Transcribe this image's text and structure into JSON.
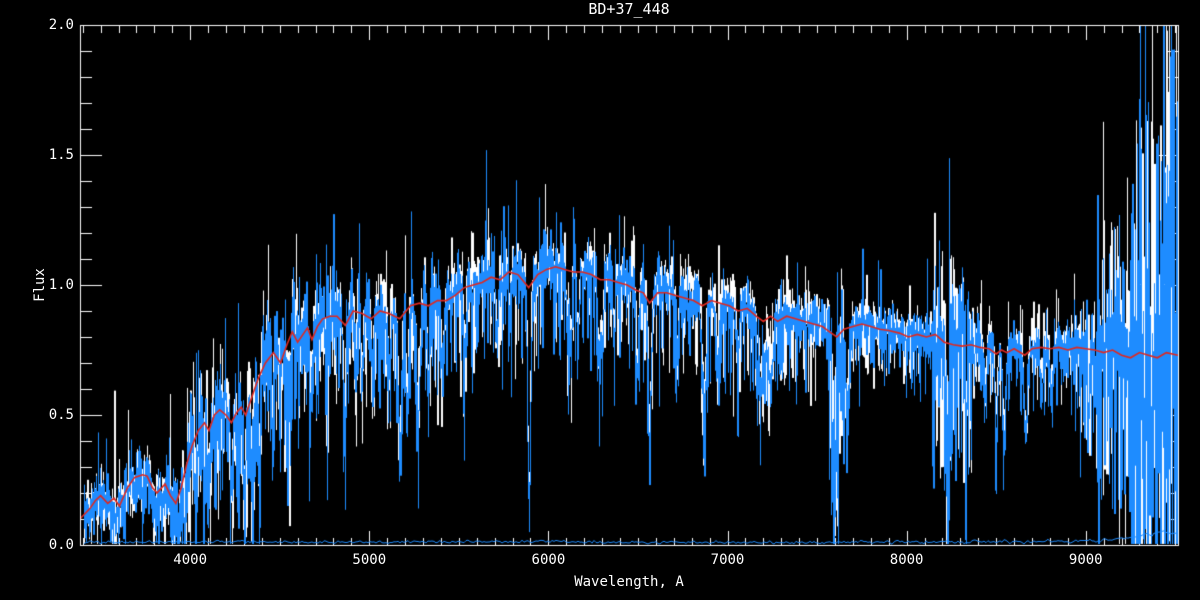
{
  "chart_data": {
    "type": "line",
    "title": "BD+37_448",
    "xlabel": "Wavelength, A",
    "ylabel": "Flux",
    "xlim": [
      3385,
      9515
    ],
    "ylim": [
      0.0,
      2.0
    ],
    "x_major_ticks": [
      4000,
      5000,
      6000,
      7000,
      8000,
      9000
    ],
    "x_minor_step": 100,
    "y_major_ticks": [
      0.0,
      0.5,
      1.0,
      1.5,
      2.0
    ],
    "y_minor_step": 0.1,
    "y_tick_decimals": 1,
    "grid": false,
    "legend": "none",
    "background_color": "#000000",
    "axis_color": "#ffffff",
    "noise_seed": 11,
    "series": [
      {
        "name": "observed-spectrum-white",
        "label": "observed spectrum (white)",
        "color": "#ffffff",
        "style": "noisy",
        "sigma_scale": 0.9,
        "line_depth_scale": 0.85
      },
      {
        "name": "observed-spectrum-blue",
        "label": "observed spectrum (blue)",
        "color": "#1e8cff",
        "style": "noisy",
        "sigma_scale": 1.0,
        "line_depth_scale": 1.0
      },
      {
        "name": "error-spectrum",
        "label": "error spectrum (bottom blue line)",
        "color": "#1e8cff",
        "style": "line",
        "width": 1,
        "points": [
          [
            3385,
            0.01
          ],
          [
            3700,
            0.012
          ],
          [
            4200,
            0.012
          ],
          [
            5000,
            0.011
          ],
          [
            5900,
            0.013
          ],
          [
            6500,
            0.01
          ],
          [
            7500,
            0.01
          ],
          [
            8200,
            0.012
          ],
          [
            8800,
            0.013
          ],
          [
            9000,
            0.016
          ],
          [
            9150,
            0.022
          ],
          [
            9280,
            0.03
          ],
          [
            9380,
            0.045
          ],
          [
            9440,
            0.055
          ],
          [
            9480,
            0.04
          ],
          [
            9515,
            0.05
          ]
        ]
      },
      {
        "name": "smoothed-spectrum-red",
        "label": "smoothed spectrum (red)",
        "color": "#e02820",
        "style": "line",
        "width": 1.6,
        "points": "continuum"
      }
    ],
    "continuum": [
      [
        3385,
        0.1
      ],
      [
        3440,
        0.14
      ],
      [
        3470,
        0.17
      ],
      [
        3500,
        0.19
      ],
      [
        3540,
        0.16
      ],
      [
        3575,
        0.18
      ],
      [
        3605,
        0.15
      ],
      [
        3650,
        0.22
      ],
      [
        3690,
        0.26
      ],
      [
        3735,
        0.27
      ],
      [
        3760,
        0.265
      ],
      [
        3790,
        0.22
      ],
      [
        3815,
        0.2
      ],
      [
        3860,
        0.235
      ],
      [
        3890,
        0.19
      ],
      [
        3920,
        0.16
      ],
      [
        3950,
        0.22
      ],
      [
        3980,
        0.31
      ],
      [
        4010,
        0.38
      ],
      [
        4045,
        0.44
      ],
      [
        4080,
        0.47
      ],
      [
        4105,
        0.44
      ],
      [
        4135,
        0.5
      ],
      [
        4165,
        0.52
      ],
      [
        4200,
        0.5
      ],
      [
        4230,
        0.47
      ],
      [
        4260,
        0.51
      ],
      [
        4285,
        0.53
      ],
      [
        4310,
        0.5
      ],
      [
        4345,
        0.57
      ],
      [
        4380,
        0.64
      ],
      [
        4420,
        0.7
      ],
      [
        4465,
        0.74
      ],
      [
        4505,
        0.7
      ],
      [
        4540,
        0.77
      ],
      [
        4570,
        0.82
      ],
      [
        4600,
        0.78
      ],
      [
        4630,
        0.81
      ],
      [
        4655,
        0.835
      ],
      [
        4680,
        0.79
      ],
      [
        4710,
        0.84
      ],
      [
        4740,
        0.87
      ],
      [
        4780,
        0.88
      ],
      [
        4820,
        0.88
      ],
      [
        4866,
        0.845
      ],
      [
        4910,
        0.9
      ],
      [
        4960,
        0.89
      ],
      [
        5010,
        0.87
      ],
      [
        5060,
        0.9
      ],
      [
        5110,
        0.89
      ],
      [
        5170,
        0.87
      ],
      [
        5230,
        0.92
      ],
      [
        5280,
        0.93
      ],
      [
        5330,
        0.92
      ],
      [
        5380,
        0.94
      ],
      [
        5430,
        0.94
      ],
      [
        5480,
        0.96
      ],
      [
        5530,
        0.99
      ],
      [
        5580,
        1.0
      ],
      [
        5630,
        1.01
      ],
      [
        5680,
        1.03
      ],
      [
        5730,
        1.02
      ],
      [
        5780,
        1.05
      ],
      [
        5830,
        1.04
      ],
      [
        5890,
        0.99
      ],
      [
        5940,
        1.04
      ],
      [
        5990,
        1.06
      ],
      [
        6040,
        1.07
      ],
      [
        6090,
        1.06
      ],
      [
        6140,
        1.05
      ],
      [
        6190,
        1.05
      ],
      [
        6240,
        1.04
      ],
      [
        6290,
        1.02
      ],
      [
        6340,
        1.02
      ],
      [
        6390,
        1.01
      ],
      [
        6440,
        1.0
      ],
      [
        6490,
        0.98
      ],
      [
        6530,
        0.97
      ],
      [
        6565,
        0.93
      ],
      [
        6610,
        0.97
      ],
      [
        6660,
        0.97
      ],
      [
        6710,
        0.96
      ],
      [
        6760,
        0.95
      ],
      [
        6810,
        0.94
      ],
      [
        6860,
        0.92
      ],
      [
        6910,
        0.94
      ],
      [
        6960,
        0.93
      ],
      [
        7010,
        0.92
      ],
      [
        7060,
        0.9
      ],
      [
        7110,
        0.91
      ],
      [
        7160,
        0.88
      ],
      [
        7200,
        0.86
      ],
      [
        7240,
        0.88
      ],
      [
        7280,
        0.86
      ],
      [
        7330,
        0.88
      ],
      [
        7380,
        0.87
      ],
      [
        7430,
        0.86
      ],
      [
        7480,
        0.85
      ],
      [
        7530,
        0.84
      ],
      [
        7570,
        0.82
      ],
      [
        7610,
        0.8
      ],
      [
        7650,
        0.83
      ],
      [
        7700,
        0.84
      ],
      [
        7750,
        0.85
      ],
      [
        7800,
        0.84
      ],
      [
        7850,
        0.83
      ],
      [
        7900,
        0.825
      ],
      [
        7960,
        0.815
      ],
      [
        8010,
        0.8
      ],
      [
        8060,
        0.81
      ],
      [
        8110,
        0.8
      ],
      [
        8160,
        0.81
      ],
      [
        8210,
        0.78
      ],
      [
        8260,
        0.77
      ],
      [
        8310,
        0.765
      ],
      [
        8360,
        0.77
      ],
      [
        8410,
        0.76
      ],
      [
        8460,
        0.755
      ],
      [
        8500,
        0.735
      ],
      [
        8530,
        0.75
      ],
      [
        8560,
        0.74
      ],
      [
        8600,
        0.755
      ],
      [
        8660,
        0.73
      ],
      [
        8700,
        0.755
      ],
      [
        8750,
        0.76
      ],
      [
        8800,
        0.755
      ],
      [
        8850,
        0.76
      ],
      [
        8900,
        0.75
      ],
      [
        8950,
        0.76
      ],
      [
        9000,
        0.755
      ],
      [
        9050,
        0.75
      ],
      [
        9100,
        0.74
      ],
      [
        9150,
        0.75
      ],
      [
        9200,
        0.73
      ],
      [
        9250,
        0.72
      ],
      [
        9300,
        0.74
      ],
      [
        9350,
        0.73
      ],
      [
        9400,
        0.72
      ],
      [
        9450,
        0.74
      ],
      [
        9515,
        0.73
      ]
    ],
    "noise_envelope": [
      [
        3385,
        0.055
      ],
      [
        3600,
        0.06
      ],
      [
        3800,
        0.065
      ],
      [
        4000,
        0.075
      ],
      [
        4200,
        0.09
      ],
      [
        4400,
        0.085
      ],
      [
        4600,
        0.08
      ],
      [
        4800,
        0.075
      ],
      [
        5000,
        0.065
      ],
      [
        5200,
        0.065
      ],
      [
        5400,
        0.06
      ],
      [
        5600,
        0.055
      ],
      [
        5800,
        0.055
      ],
      [
        6000,
        0.05
      ],
      [
        6200,
        0.05
      ],
      [
        6400,
        0.045
      ],
      [
        6600,
        0.045
      ],
      [
        6800,
        0.045
      ],
      [
        7000,
        0.04
      ],
      [
        7200,
        0.045
      ],
      [
        7400,
        0.04
      ],
      [
        7550,
        0.05
      ],
      [
        7600,
        0.08
      ],
      [
        7650,
        0.045
      ],
      [
        7800,
        0.04
      ],
      [
        8000,
        0.04
      ],
      [
        8100,
        0.05
      ],
      [
        8150,
        0.08
      ],
      [
        8250,
        0.09
      ],
      [
        8350,
        0.06
      ],
      [
        8450,
        0.04
      ],
      [
        8600,
        0.04
      ],
      [
        8800,
        0.045
      ],
      [
        8950,
        0.06
      ],
      [
        9000,
        0.07
      ],
      [
        9100,
        0.1
      ],
      [
        9200,
        0.13
      ],
      [
        9300,
        0.22
      ],
      [
        9400,
        0.34
      ],
      [
        9470,
        0.42
      ],
      [
        9515,
        0.5
      ]
    ],
    "white_offset": [
      [
        3385,
        0.0
      ],
      [
        4500,
        0.0
      ],
      [
        5200,
        0.01
      ],
      [
        5600,
        0.02
      ],
      [
        6200,
        0.025
      ],
      [
        6700,
        0.03
      ],
      [
        7100,
        0.035
      ],
      [
        7400,
        0.03
      ],
      [
        7600,
        0.02
      ],
      [
        7900,
        0.015
      ],
      [
        8200,
        0.02
      ],
      [
        8350,
        0.035
      ],
      [
        8600,
        0.03
      ],
      [
        8800,
        0.015
      ],
      [
        9000,
        0.005
      ],
      [
        9515,
        0.0
      ]
    ],
    "absorption_lines": [
      [
        3560,
        0.45,
        22
      ],
      [
        3580,
        0.35,
        10
      ],
      [
        3620,
        0.3,
        8
      ],
      [
        3735,
        0.3,
        8
      ],
      [
        3790,
        0.35,
        12
      ],
      [
        3810,
        0.4,
        14
      ],
      [
        3840,
        0.35,
        8
      ],
      [
        3890,
        0.4,
        10
      ],
      [
        3933,
        0.8,
        7
      ],
      [
        3968,
        0.7,
        7
      ],
      [
        4030,
        0.45,
        8
      ],
      [
        4077,
        0.35,
        6
      ],
      [
        4101,
        0.5,
        8
      ],
      [
        4144,
        0.35,
        7
      ],
      [
        4226,
        0.6,
        7
      ],
      [
        4260,
        0.35,
        7
      ],
      [
        4300,
        0.5,
        10
      ],
      [
        4340,
        0.45,
        8
      ],
      [
        4383,
        0.55,
        7
      ],
      [
        4455,
        0.4,
        7
      ],
      [
        4531,
        0.35,
        7
      ],
      [
        4554,
        0.3,
        6
      ],
      [
        4668,
        0.35,
        8
      ],
      [
        4762,
        0.3,
        8
      ],
      [
        4861,
        0.45,
        8
      ],
      [
        4920,
        0.3,
        6
      ],
      [
        4957,
        0.3,
        6
      ],
      [
        5015,
        0.3,
        6
      ],
      [
        5110,
        0.3,
        6
      ],
      [
        5170,
        0.55,
        10
      ],
      [
        5208,
        0.45,
        8
      ],
      [
        5270,
        0.5,
        10
      ],
      [
        5328,
        0.35,
        7
      ],
      [
        5406,
        0.3,
        7
      ],
      [
        5530,
        0.25,
        8
      ],
      [
        5710,
        0.25,
        8
      ],
      [
        5782,
        0.2,
        6
      ],
      [
        5890,
        0.9,
        8
      ],
      [
        6102,
        0.25,
        6
      ],
      [
        6122,
        0.3,
        6
      ],
      [
        6162,
        0.3,
        6
      ],
      [
        6280,
        0.35,
        8
      ],
      [
        6300,
        0.3,
        5
      ],
      [
        6363,
        0.25,
        5
      ],
      [
        6494,
        0.3,
        7
      ],
      [
        6563,
        0.6,
        8
      ],
      [
        6717,
        0.25,
        6
      ],
      [
        6867,
        0.45,
        12
      ],
      [
        6940,
        0.25,
        10
      ],
      [
        7054,
        0.25,
        8
      ],
      [
        7186,
        0.3,
        18
      ],
      [
        7240,
        0.3,
        14
      ],
      [
        7594,
        0.6,
        16
      ],
      [
        7665,
        0.35,
        10
      ],
      [
        8227,
        0.55,
        8
      ],
      [
        8328,
        0.35,
        7
      ],
      [
        8434,
        0.3,
        8
      ],
      [
        8498,
        0.4,
        8
      ],
      [
        8542,
        0.5,
        9
      ],
      [
        8662,
        0.45,
        9
      ],
      [
        8750,
        0.25,
        8
      ],
      [
        8806,
        0.25,
        7
      ],
      [
        9015,
        0.3,
        8
      ],
      [
        9062,
        0.3,
        8
      ]
    ],
    "spike_regions": [
      {
        "from": 3900,
        "to": 4000,
        "prob": 0.25,
        "up": 0.05,
        "down": 0.22
      },
      {
        "from": 4000,
        "to": 4600,
        "prob": 0.3,
        "up": 0.18,
        "down": 0.35
      },
      {
        "from": 4600,
        "to": 5400,
        "prob": 0.25,
        "up": 0.12,
        "down": 0.3
      },
      {
        "from": 5400,
        "to": 6400,
        "prob": 0.2,
        "up": 0.1,
        "down": 0.35
      },
      {
        "from": 6400,
        "to": 7500,
        "prob": 0.22,
        "up": 0.08,
        "down": 0.32
      },
      {
        "from": 7560,
        "to": 7650,
        "prob": 0.5,
        "up": 0.28,
        "down": 0.5
      },
      {
        "from": 7650,
        "to": 8100,
        "prob": 0.15,
        "up": 0.06,
        "down": 0.2
      },
      {
        "from": 8140,
        "to": 8360,
        "prob": 0.45,
        "up": 0.22,
        "down": 0.55
      },
      {
        "from": 8360,
        "to": 8900,
        "prob": 0.15,
        "up": 0.05,
        "down": 0.25
      },
      {
        "from": 8930,
        "to": 9060,
        "prob": 0.35,
        "up": 0.2,
        "down": 0.35
      },
      {
        "from": 9060,
        "to": 9250,
        "prob": 0.5,
        "up": 0.35,
        "down": 0.55
      },
      {
        "from": 9250,
        "to": 9430,
        "prob": 0.7,
        "up": 0.85,
        "down": 0.7
      },
      {
        "from": 9430,
        "to": 9515,
        "prob": 0.85,
        "up": 1.25,
        "down": 0.75
      }
    ]
  }
}
